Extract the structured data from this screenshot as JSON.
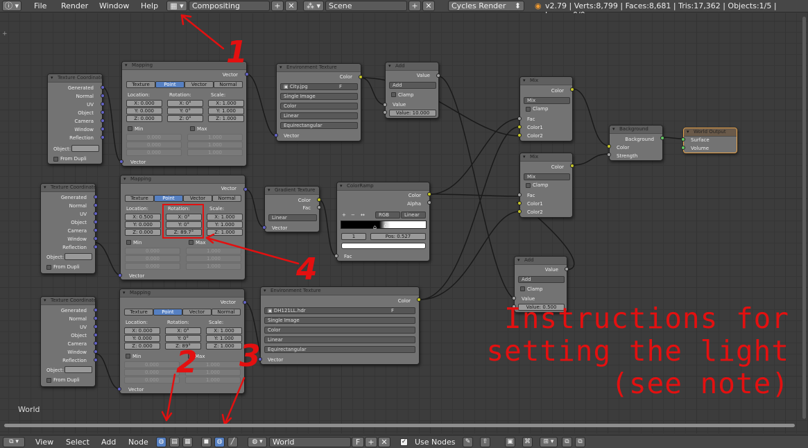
{
  "topbar": {
    "info_icon": "info-icon",
    "menu": [
      "File",
      "Render",
      "Window",
      "Help"
    ],
    "screen_layout": "Compositing",
    "scene": "Scene",
    "render_engine": "Cycles Render",
    "stats": "v2.79 | Verts:8,799 | Faces:8,681 | Tris:17,362 | Objects:1/5 | Lamps:0/0"
  },
  "editor_label": "World",
  "texcoord_outputs": [
    "Generated",
    "Normal",
    "UV",
    "Object",
    "Camera",
    "Window",
    "Reflection"
  ],
  "texcoord": {
    "title": "Texture Coordinate",
    "object_label": "Object:",
    "from_dupli": "From Dupli"
  },
  "mapping_common": {
    "title": "Mapping",
    "vector": "Vector",
    "types": [
      "Texture",
      "Point",
      "Vector",
      "Normal"
    ],
    "location": "Location:",
    "rotation": "Rotation:",
    "scale": "Scale:",
    "min": "Min",
    "max": "Max",
    "axes": [
      "X:",
      "Y:",
      "Z:"
    ],
    "disabled_min": "0.000",
    "disabled_max": "1.000"
  },
  "mapping1": {
    "loc": [
      "0.000",
      "0.000",
      "0.000"
    ],
    "rot": [
      "0°",
      "0°",
      "0°"
    ],
    "scale": [
      "1.000",
      "1.000",
      "1.000"
    ]
  },
  "mapping2": {
    "loc": [
      "0.500",
      "0.000",
      "0.000"
    ],
    "rot": [
      "0°",
      "0°",
      "89.7°"
    ],
    "scale": [
      "1.000",
      "1.000",
      "1.000"
    ]
  },
  "mapping3": {
    "loc": [
      "0.000",
      "0.000",
      "0.000"
    ],
    "rot": [
      "0°",
      "0°",
      "89°"
    ],
    "scale": [
      "1.000",
      "1.000",
      "1.000"
    ]
  },
  "env1": {
    "title": "Environment Texture",
    "color": "Color",
    "image": "City.jpg",
    "f": "F",
    "source": "Single Image",
    "colorspace": "Color",
    "interp": "Linear",
    "projection": "Equirectangular",
    "vector": "Vector"
  },
  "env2": {
    "title": "Environment Texture",
    "color": "Color",
    "image": "DH121LL.hdr",
    "f": "F",
    "source": "Single Image",
    "colorspace": "Color",
    "interp": "Linear",
    "projection": "Equirectangular",
    "vector": "Vector"
  },
  "add1": {
    "title": "Add",
    "value_out": "Value",
    "op": "Add",
    "clamp": "Clamp",
    "value_in": "Value",
    "value_field": "Value:",
    "value": "10.000"
  },
  "add2": {
    "title": "Add",
    "value_out": "Value",
    "op": "Add",
    "clamp": "Clamp",
    "value_in": "Value",
    "value_field": "Value:",
    "value": "0.500"
  },
  "gradient": {
    "title": "Gradient Texture",
    "color": "Color",
    "fac": "Fac",
    "type": "Linear",
    "vector": "Vector"
  },
  "colorramp": {
    "title": "ColorRamp",
    "color": "Color",
    "alpha": "Alpha",
    "plus": "+",
    "minus": "−",
    "flip": "↔",
    "mode": "RGB",
    "interp": "Linear",
    "index": "1",
    "pos_label": "Pos:",
    "pos": "0.527",
    "fac": "Fac"
  },
  "mix": {
    "title": "Mix",
    "color": "Color",
    "op": "Mix",
    "clamp": "Clamp",
    "fac": "Fac",
    "color1": "Color1",
    "color2": "Color2"
  },
  "background": {
    "title": "Background",
    "out": "Background",
    "color": "Color",
    "strength": "Strength"
  },
  "world_output": {
    "title": "World Output",
    "surface": "Surface",
    "volume": "Volume"
  },
  "annotations": {
    "n1": "1",
    "n2": "2",
    "n3": "3",
    "n4": "4",
    "note": "Instructions for\nsetting the light\n(see note)"
  },
  "bottombar": {
    "menu": [
      "View",
      "Select",
      "Add",
      "Node"
    ],
    "world_name": "World",
    "f": "F",
    "use_nodes": "Use Nodes"
  },
  "colors": {
    "annotation": "#e31010",
    "socket_color": "#c7c729",
    "socket_vector": "#6363c7",
    "socket_value": "#a1a1a1",
    "socket_shader": "#63c763",
    "active_button": "#5680c2",
    "selected_outline": "#e8a34a"
  }
}
